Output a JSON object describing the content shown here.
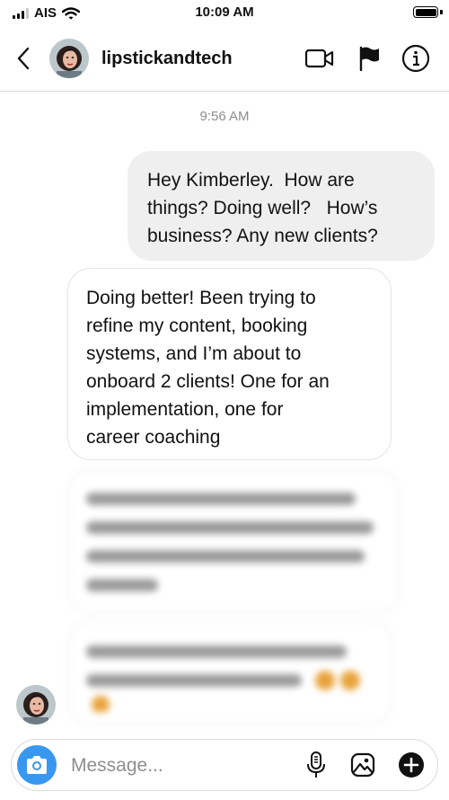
{
  "status_bar": {
    "carrier": "AIS",
    "time": "10:09 AM"
  },
  "header": {
    "username": "lipstickandtech",
    "icons": [
      "back-chevron-icon",
      "video-camera-icon",
      "flag-icon",
      "info-icon"
    ]
  },
  "conversation": {
    "timestamp": "9:56 AM",
    "messages": [
      {
        "direction": "outgoing",
        "lines": [
          "Hey Kimberley.  How are",
          "things? Doing well?   How’s",
          "business? Any new clients?"
        ]
      },
      {
        "direction": "incoming",
        "lines": [
          "Doing better! Been trying to",
          "refine my content, booking",
          "systems, and I’m about to",
          "onboard 2 clients! One for an",
          "implementation, one for",
          "career coaching"
        ]
      }
    ]
  },
  "composer": {
    "placeholder": "Message...",
    "icons": [
      "camera-icon",
      "microphone-icon",
      "gallery-icon",
      "plus-icon"
    ]
  },
  "colors": {
    "accent": "#3897f0",
    "outgoing_bubble": "#efefef",
    "incoming_border": "#e4e4e4",
    "secondary_text": "#8e8e8e"
  }
}
